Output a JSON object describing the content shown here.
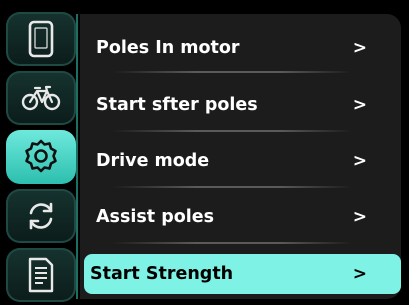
{
  "sidebar": {
    "items": [
      {
        "icon": "phone-icon",
        "active": false
      },
      {
        "icon": "bicycle-icon",
        "active": false
      },
      {
        "icon": "gear-icon",
        "active": true
      },
      {
        "icon": "sync-icon",
        "active": false
      },
      {
        "icon": "document-icon",
        "active": false
      }
    ]
  },
  "menu": {
    "items": [
      {
        "label": "Poles In motor",
        "arrow": ">"
      },
      {
        "label": "Start  sfter poles",
        "arrow": ">"
      },
      {
        "label": "Drive mode",
        "arrow": ">"
      },
      {
        "label": "Assist poles",
        "arrow": ">"
      },
      {
        "label": "Start Strength",
        "arrow": ">",
        "selected": true
      }
    ]
  },
  "colors": {
    "accent": "#7ff2e6",
    "panel": "#1c1c1c",
    "background": "#000000"
  }
}
